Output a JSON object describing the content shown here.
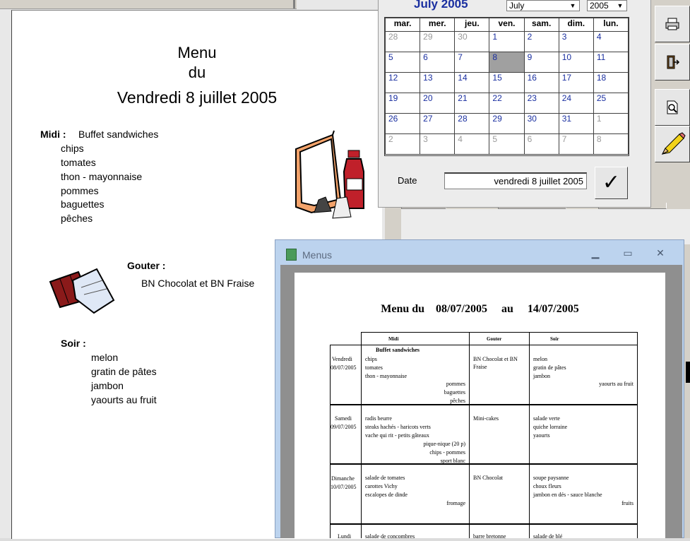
{
  "doc": {
    "title_line1": "Menu",
    "title_line2": "du",
    "title_line3": "Vendredi 8 juillet 2005",
    "midi_label": "Midi :",
    "midi_first": "Buffet sandwiches",
    "midi_items": [
      "chips",
      "tomates",
      "thon - mayonnaise",
      "pommes",
      "baguettes",
      "pêches"
    ],
    "gouter_label": "Gouter :",
    "gouter_text": "BN Chocolat et BN Fraise",
    "soir_label": "Soir :",
    "soir_items": [
      "melon",
      "gratin de pâtes",
      "jambon",
      "yaourts au fruit"
    ]
  },
  "calendar": {
    "month_title": "July 2005",
    "month_select": "July",
    "year_select": "2005",
    "weekdays": [
      "mar.",
      "mer.",
      "jeu.",
      "ven.",
      "sam.",
      "dim.",
      "lun."
    ],
    "weeks": [
      [
        "28",
        "29",
        "30",
        "1",
        "2",
        "3",
        "4"
      ],
      [
        "5",
        "6",
        "7",
        "8",
        "9",
        "10",
        "11"
      ],
      [
        "12",
        "13",
        "14",
        "15",
        "16",
        "17",
        "18"
      ],
      [
        "19",
        "20",
        "21",
        "22",
        "23",
        "24",
        "25"
      ],
      [
        "26",
        "27",
        "28",
        "29",
        "30",
        "31",
        "1"
      ],
      [
        "2",
        "3",
        "4",
        "5",
        "6",
        "7",
        "8"
      ]
    ],
    "date_label": "Date",
    "date_value": "vendredi 8 juillet 2005",
    "ok_symbol": "✓"
  },
  "menus_window": {
    "title": "Menus",
    "report_title": "Menu du    08/07/2005     au     14/07/2005",
    "columns": [
      "Midi",
      "Gouter",
      "Soir"
    ],
    "rows": [
      {
        "day": "Vendredi",
        "date": "08/07/2005",
        "midi_head": "Buffet sandwiches",
        "midi_left": [
          "chips",
          "tomates",
          "thon - mayonnaise"
        ],
        "midi_right": [
          "pommes",
          "baguettes",
          "pêches"
        ],
        "gouter": [
          "BN Chocolat et BN",
          "Fraise"
        ],
        "soir_left": [
          "melon",
          "gratin de pâtes",
          "jambon"
        ],
        "soir_right": [
          "yaourts au fruit"
        ]
      },
      {
        "day": "Samedi",
        "date": "09/07/2005",
        "midi_head": "",
        "midi_left": [
          "radis beurre",
          "steaks hachés - haricots verts",
          "vache qui rit - petits gâteaux"
        ],
        "midi_right": [
          "pique-nique (20 p)",
          "chips - pommes",
          "sport blanc"
        ],
        "gouter": [
          "Mini-cakes"
        ],
        "soir_left": [
          "salade verte",
          "quiche lorraine",
          "yaourts"
        ],
        "soir_right": []
      },
      {
        "day": "Dimanche",
        "date": "10/07/2005",
        "midi_head": "",
        "midi_left": [
          "salade de tomates",
          "carottes Vichy",
          "escalopes de dinde"
        ],
        "midi_right": [
          "fromage"
        ],
        "gouter": [
          "BN Chocolat"
        ],
        "soir_left": [
          "soupe paysanne",
          "choux fleurs",
          "jambon en dés - sauce blanche"
        ],
        "soir_right": [
          "fruits"
        ]
      },
      {
        "day": "Lundi",
        "date": "",
        "midi_head": "",
        "midi_left": [
          "salade de concombres"
        ],
        "midi_right": [],
        "gouter": [
          "barre bretonne"
        ],
        "soir_left": [
          "salade de blé"
        ],
        "soir_right": []
      }
    ]
  },
  "colors": {
    "accent_blue": "#1a2fa0",
    "selected_day": "#a0a0a0",
    "window_frame": "#bcd3ee"
  },
  "icons": [
    "printer-icon",
    "exit-icon",
    "preview-icon",
    "pencil-icon",
    "checkmark-icon",
    "menu-board-icon",
    "chocolate-bar-icon"
  ]
}
